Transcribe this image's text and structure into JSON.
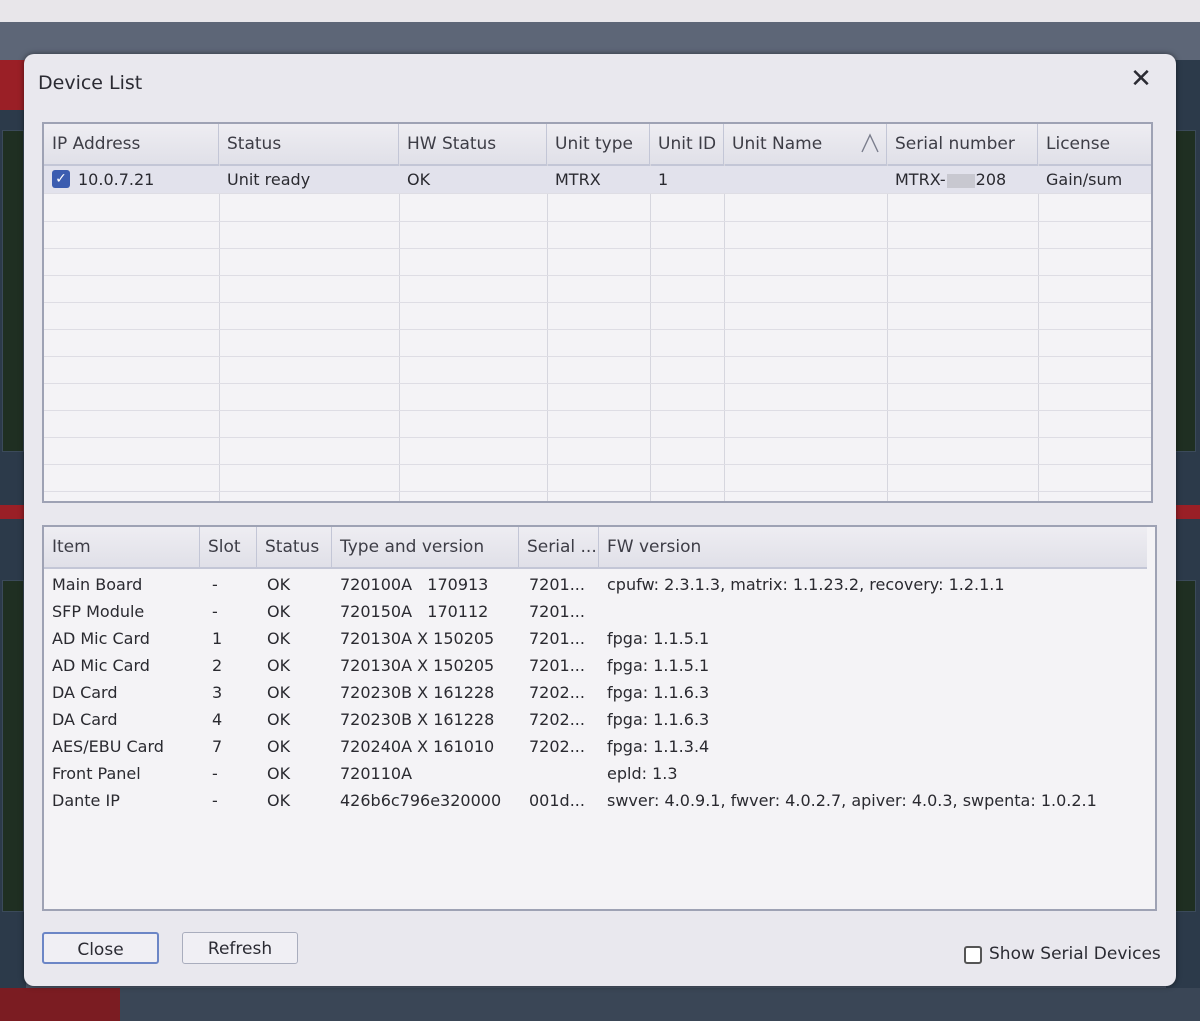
{
  "dialog": {
    "title": "Device List",
    "close_glyph": "✕"
  },
  "device_table": {
    "columns": [
      "IP Address",
      "Status",
      "HW Status",
      "Unit type",
      "Unit ID",
      "Unit Name",
      "Serial number",
      "License"
    ],
    "sorted_column": "Unit Name",
    "rows": [
      {
        "checked": true,
        "ip": "10.0.7.21",
        "status": "Unit ready",
        "hw_status": "OK",
        "unit_type": "MTRX",
        "unit_id": "1",
        "unit_name": "",
        "serial_prefix": "MTRX-",
        "serial_suffix": "208",
        "license": "Gain/sum"
      }
    ]
  },
  "module_table": {
    "columns": [
      "Item",
      "Slot",
      "Status",
      "Type and version",
      "Serial ...",
      "FW version"
    ],
    "rows": [
      {
        "item": "Main Board",
        "slot": "-",
        "status": "OK",
        "type": "720100A   170913",
        "serial": "7201...",
        "fw": "cpufw: 2.3.1.3, matrix: 1.1.23.2, recovery: 1.2.1.1"
      },
      {
        "item": "SFP Module",
        "slot": "-",
        "status": "OK",
        "type": "720150A   170112",
        "serial": "7201...",
        "fw": ""
      },
      {
        "item": "AD Mic Card",
        "slot": "1",
        "status": "OK",
        "type": "720130A X 150205",
        "serial": "7201...",
        "fw": "fpga: 1.1.5.1"
      },
      {
        "item": "AD Mic Card",
        "slot": "2",
        "status": "OK",
        "type": "720130A X 150205",
        "serial": "7201...",
        "fw": "fpga: 1.1.5.1"
      },
      {
        "item": "DA Card",
        "slot": "3",
        "status": "OK",
        "type": "720230B X 161228",
        "serial": "7202...",
        "fw": "fpga: 1.1.6.3"
      },
      {
        "item": "DA Card",
        "slot": "4",
        "status": "OK",
        "type": "720230B X 161228",
        "serial": "7202...",
        "fw": "fpga: 1.1.6.3"
      },
      {
        "item": "AES/EBU Card",
        "slot": "7",
        "status": "OK",
        "type": "720240A X 161010",
        "serial": "7202...",
        "fw": "fpga: 1.1.3.4"
      },
      {
        "item": "Front Panel",
        "slot": "-",
        "status": "OK",
        "type": "720110A",
        "serial": "",
        "fw": "epld: 1.3"
      },
      {
        "item": "Dante IP",
        "slot": "-",
        "status": "OK",
        "type": "426b6c796e320000",
        "serial": "001d...",
        "fw": "swver: 4.0.9.1, fwver: 4.0.2.7, apiver: 4.0.3, swpenta: 1.0.2.1"
      }
    ]
  },
  "footer": {
    "close_label": "Close",
    "refresh_label": "Refresh",
    "show_serial_label": "Show Serial Devices",
    "show_serial_checked": false
  },
  "colors": {
    "accent": "#3c5db0",
    "dialog_bg": "#e9e8ee"
  }
}
